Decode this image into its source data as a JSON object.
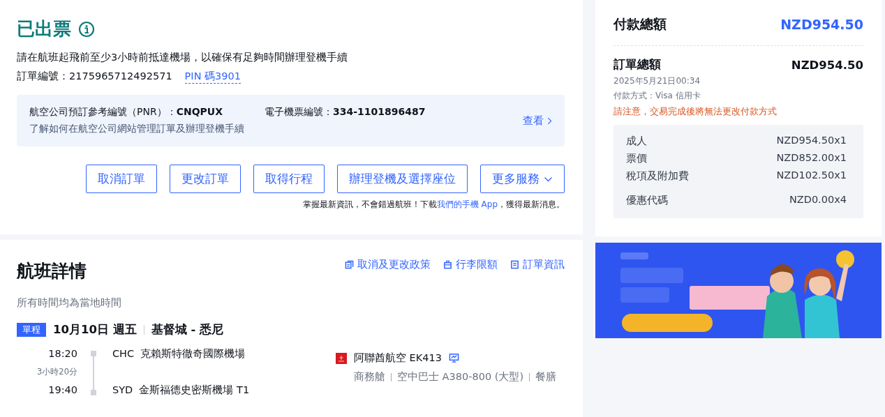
{
  "status": {
    "title": "已出票",
    "note": "請在航班起飛前至少3小時前抵達機場，以確保有足夠時間辦理登機手續",
    "order_number": "訂單編號：2175965712492571",
    "pin": "PIN 碼3901"
  },
  "booking_box": {
    "pnr": "航空公司預訂參考編號（PNR）：**CNQPUX**",
    "ticket": "電子機票編號：**334-1101896487**",
    "help": "了解如何在航空公司網站管理訂單及辦理登機手續",
    "view_link": "查看"
  },
  "actions": [
    {
      "label": "取消訂單",
      "kind": "button"
    },
    {
      "label": "更改訂單",
      "kind": "button"
    },
    {
      "label": "取得行程",
      "kind": "button"
    },
    {
      "label": "辦理登機及選擇座位",
      "kind": "button"
    },
    {
      "label": "更多服務",
      "kind": "dropdown"
    }
  ],
  "app_note": {
    "before": "掌握最新資訊，不會錯過航班！下載",
    "link": "我們的手機 App",
    "after": "，獲得最新消息。"
  },
  "flight": {
    "title": "航班詳情",
    "links": [
      {
        "label": "取消及更改政策",
        "kind": "policy"
      },
      {
        "label": "行李限額",
        "kind": "baggage"
      },
      {
        "label": "訂單資訊",
        "kind": "order"
      }
    ],
    "timezone_note": "所有時間均為當地時間",
    "trip_type": "單程",
    "date": "10月10日 週五",
    "route": "基督城 - 悉尼",
    "departure": {
      "time": "18:20",
      "code": "CHC",
      "airport": "克賴斯特徹奇國際機場"
    },
    "duration": "3小時20分",
    "arrival": {
      "time": "19:40",
      "code": "SYD",
      "airport": "金斯福德史密斯機場 T1"
    },
    "airline": "阿聯酋航空 EK413",
    "details": [
      "商務艙",
      "空中巴士 A380-800 (大型)",
      "餐膳"
    ]
  },
  "payment": {
    "title": "付款總額",
    "total": "NZD954.50",
    "order_total_label": "訂單總額",
    "order_total": "NZD954.50",
    "date": "2025年5月21日00:34",
    "method": "付款方式：Visa 信用卡",
    "warning": "請注意，交易完成後將無法更改付款方式",
    "items": [
      {
        "label": "成人",
        "amount": "NZD954.50x1"
      },
      {
        "label": "票價",
        "amount": "NZD852.00x1"
      },
      {
        "label": "稅項及附加費",
        "amount": "NZD102.50x1"
      }
    ],
    "discount": {
      "label": "優惠代碼",
      "amount": "NZD0.00x4"
    }
  }
}
